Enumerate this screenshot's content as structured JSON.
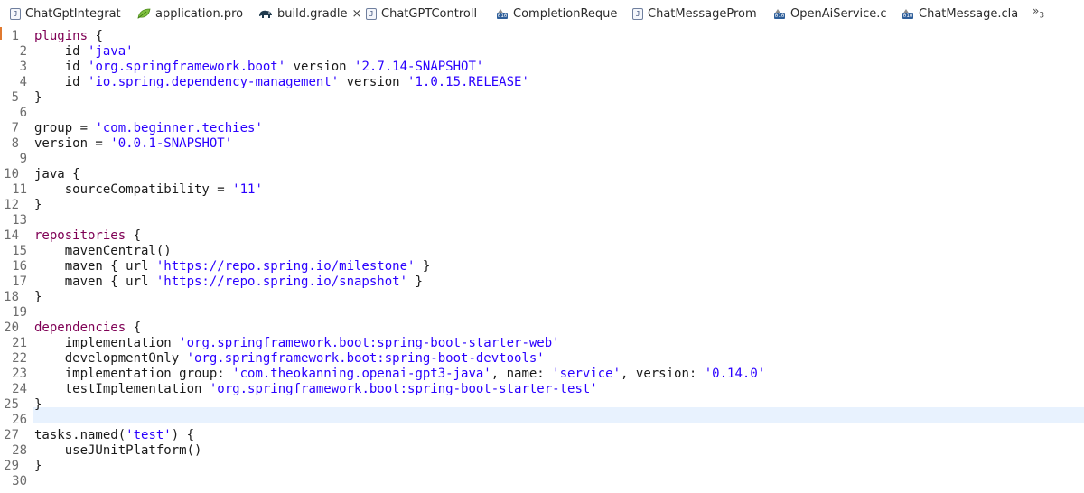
{
  "tabs": [
    {
      "label": "ChatGptIntegrat",
      "icon": "java-file-icon"
    },
    {
      "label": "application.pro",
      "icon": "properties-leaf-icon"
    },
    {
      "label": "build.gradle",
      "icon": "gradle-elephant-icon",
      "active": true,
      "close": "×"
    },
    {
      "label": "ChatGPTControll",
      "icon": "java-file-icon"
    },
    {
      "label": "CompletionReque",
      "icon": "class-file-icon"
    },
    {
      "label": "ChatMessageProm",
      "icon": "java-file-icon"
    },
    {
      "label": "OpenAiService.c",
      "icon": "class-file-icon"
    },
    {
      "label": "ChatMessage.cla",
      "icon": "class-file-icon"
    }
  ],
  "overflow": {
    "glyph": "»",
    "count": "3"
  },
  "icon_text": {
    "java": "J",
    "class": "010"
  },
  "colors": {
    "keyword": "#7f0055",
    "string": "#2a00ff",
    "text": "#1a1a1a",
    "line_number": "#6d6d6d",
    "current_line": "#e8f2fe",
    "change_marker": "#e0792f"
  },
  "lines": [
    {
      "num": "1",
      "fold": true,
      "parts": [
        {
          "k": "kw",
          "t": "plugins"
        },
        {
          "k": "plain",
          "t": " {"
        }
      ]
    },
    {
      "num": "2",
      "parts": [
        {
          "k": "plain",
          "t": "    id "
        },
        {
          "k": "str",
          "t": "'java'"
        }
      ]
    },
    {
      "num": "3",
      "parts": [
        {
          "k": "plain",
          "t": "    id "
        },
        {
          "k": "str",
          "t": "'org.springframework.boot'"
        },
        {
          "k": "plain",
          "t": " version "
        },
        {
          "k": "str",
          "t": "'2.7.14-SNAPSHOT'"
        }
      ]
    },
    {
      "num": "4",
      "parts": [
        {
          "k": "plain",
          "t": "    id "
        },
        {
          "k": "str",
          "t": "'io.spring.dependency-management'"
        },
        {
          "k": "plain",
          "t": " version "
        },
        {
          "k": "str",
          "t": "'1.0.15.RELEASE'"
        }
      ]
    },
    {
      "num": "5",
      "fold": true,
      "parts": [
        {
          "k": "plain",
          "t": "}"
        }
      ]
    },
    {
      "num": "6",
      "parts": []
    },
    {
      "num": "7",
      "fold": true,
      "parts": [
        {
          "k": "plain",
          "t": "group = "
        },
        {
          "k": "str",
          "t": "'com.beginner.techies'"
        }
      ]
    },
    {
      "num": "8",
      "fold": true,
      "parts": [
        {
          "k": "plain",
          "t": "version = "
        },
        {
          "k": "str",
          "t": "'0.0.1-SNAPSHOT'"
        }
      ]
    },
    {
      "num": "9",
      "parts": []
    },
    {
      "num": "10",
      "fold": true,
      "parts": [
        {
          "k": "plain",
          "t": "java {"
        }
      ]
    },
    {
      "num": "11",
      "parts": [
        {
          "k": "plain",
          "t": "    sourceCompatibility = "
        },
        {
          "k": "str",
          "t": "'11'"
        }
      ]
    },
    {
      "num": "12",
      "fold": true,
      "parts": [
        {
          "k": "plain",
          "t": "}"
        }
      ]
    },
    {
      "num": "13",
      "parts": []
    },
    {
      "num": "14",
      "fold": true,
      "parts": [
        {
          "k": "kw",
          "t": "repositories"
        },
        {
          "k": "plain",
          "t": " {"
        }
      ]
    },
    {
      "num": "15",
      "parts": [
        {
          "k": "plain",
          "t": "    mavenCentral()"
        }
      ]
    },
    {
      "num": "16",
      "parts": [
        {
          "k": "plain",
          "t": "    maven { url "
        },
        {
          "k": "str",
          "t": "'https://repo.spring.io/milestone'"
        },
        {
          "k": "plain",
          "t": " }"
        }
      ]
    },
    {
      "num": "17",
      "parts": [
        {
          "k": "plain",
          "t": "    maven { url "
        },
        {
          "k": "str",
          "t": "'https://repo.spring.io/snapshot'"
        },
        {
          "k": "plain",
          "t": " }"
        }
      ]
    },
    {
      "num": "18",
      "fold": true,
      "parts": [
        {
          "k": "plain",
          "t": "}"
        }
      ]
    },
    {
      "num": "19",
      "parts": []
    },
    {
      "num": "20",
      "fold": true,
      "parts": [
        {
          "k": "kw",
          "t": "dependencies"
        },
        {
          "k": "plain",
          "t": " {"
        }
      ]
    },
    {
      "num": "21",
      "parts": [
        {
          "k": "plain",
          "t": "    implementation "
        },
        {
          "k": "str",
          "t": "'org.springframework.boot:spring-boot-starter-web'"
        }
      ]
    },
    {
      "num": "22",
      "parts": [
        {
          "k": "plain",
          "t": "    developmentOnly "
        },
        {
          "k": "str",
          "t": "'org.springframework.boot:spring-boot-devtools'"
        }
      ]
    },
    {
      "num": "23",
      "parts": [
        {
          "k": "plain",
          "t": "    implementation group: "
        },
        {
          "k": "str",
          "t": "'com.theokanning.openai-gpt3-java'"
        },
        {
          "k": "plain",
          "t": ", name: "
        },
        {
          "k": "str",
          "t": "'service'"
        },
        {
          "k": "plain",
          "t": ", version: "
        },
        {
          "k": "str",
          "t": "'0.14.0'"
        }
      ]
    },
    {
      "num": "24",
      "parts": [
        {
          "k": "plain",
          "t": "    testImplementation "
        },
        {
          "k": "str",
          "t": "'org.springframework.boot:spring-boot-starter-test'"
        }
      ]
    },
    {
      "num": "25",
      "fold": true,
      "parts": [
        {
          "k": "plain",
          "t": "}"
        }
      ]
    },
    {
      "num": "26",
      "current": true,
      "parts": []
    },
    {
      "num": "27",
      "fold": true,
      "parts": [
        {
          "k": "plain",
          "t": "tasks.named("
        },
        {
          "k": "str",
          "t": "'test'"
        },
        {
          "k": "plain",
          "t": ") {"
        }
      ]
    },
    {
      "num": "28",
      "parts": [
        {
          "k": "plain",
          "t": "    useJUnitPlatform()"
        }
      ]
    },
    {
      "num": "29",
      "fold": true,
      "parts": [
        {
          "k": "plain",
          "t": "}"
        }
      ]
    },
    {
      "num": "30",
      "parts": []
    }
  ]
}
